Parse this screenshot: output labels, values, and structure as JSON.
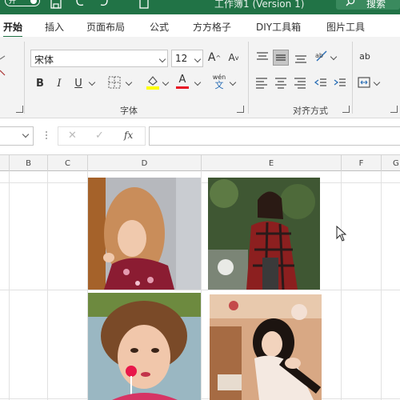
{
  "titlebar": {
    "autosave_label": "开",
    "title": "工作簿1 (Version 1)",
    "search_label": "搜索",
    "color": "#217346"
  },
  "tabs": [
    {
      "label": "开始",
      "active": true
    },
    {
      "label": "插入"
    },
    {
      "label": "页面布局"
    },
    {
      "label": "公式"
    },
    {
      "label": "方方格子"
    },
    {
      "label": "DIY工具箱"
    },
    {
      "label": "图片工具"
    }
  ],
  "ribbon": {
    "font": {
      "name": "宋体",
      "size": "12",
      "group_label": "字体",
      "grow_label": "A",
      "shrink_label": "A",
      "bold": "B",
      "italic": "I",
      "underline": "U",
      "font_color_label": "A",
      "phonetic_label": "wén"
    },
    "alignment": {
      "group_label": "对齐方式"
    },
    "number": {
      "wrap_label": "ab"
    }
  },
  "formula_bar": {
    "fx_label": "fx",
    "cancel_label": "✕",
    "enter_label": "✓",
    "name_box_value": "",
    "formula_value": ""
  },
  "columns": [
    "B",
    "C",
    "D",
    "E",
    "F",
    "G"
  ],
  "images": [
    {
      "name": "photo-woman-leaning",
      "cell": "D"
    },
    {
      "name": "photo-woman-plaid-coat",
      "cell": "E"
    },
    {
      "name": "photo-woman-lollipop",
      "cell": "D"
    },
    {
      "name": "photo-woman-kitchen",
      "cell": "E"
    }
  ]
}
